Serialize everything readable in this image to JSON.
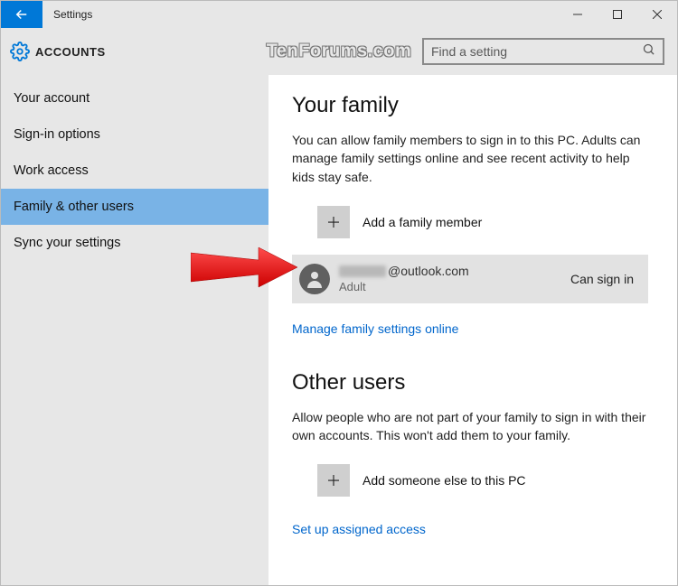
{
  "titlebar": {
    "title": "Settings"
  },
  "header": {
    "title": "ACCOUNTS",
    "watermark": "TenForums.com"
  },
  "search": {
    "placeholder": "Find a setting"
  },
  "sidebar": {
    "items": [
      {
        "label": "Your account"
      },
      {
        "label": "Sign-in options"
      },
      {
        "label": "Work access"
      },
      {
        "label": "Family & other users"
      },
      {
        "label": "Sync your settings"
      }
    ]
  },
  "content": {
    "family": {
      "heading": "Your family",
      "desc": "You can allow family members to sign in to this PC. Adults can manage family settings online and see recent activity to help kids stay safe.",
      "add_label": "Add a family member",
      "member": {
        "email_suffix": "@outlook.com",
        "role": "Adult",
        "status": "Can sign in"
      },
      "link": "Manage family settings online"
    },
    "other": {
      "heading": "Other users",
      "desc": "Allow people who are not part of your family to sign in with their own accounts. This won't add them to your family.",
      "add_label": "Add someone else to this PC",
      "link": "Set up assigned access"
    }
  }
}
